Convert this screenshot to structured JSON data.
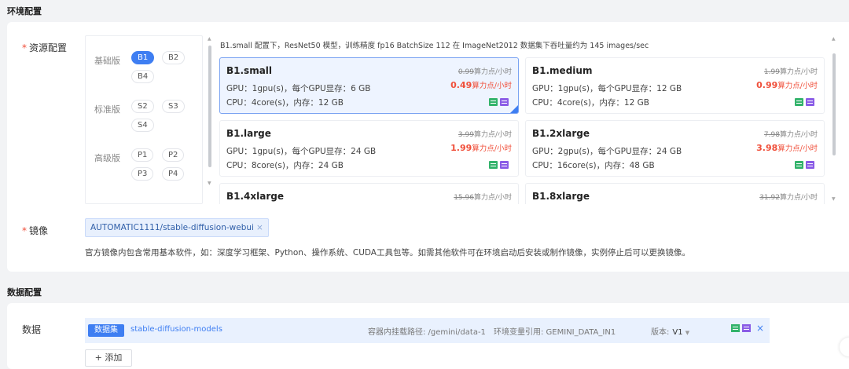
{
  "env_section": {
    "title": "环境配置",
    "resource_label": "资源配置",
    "required_mark": "*",
    "tiers": [
      {
        "name": "基础版",
        "options": [
          "B1",
          "B2",
          "B4"
        ],
        "selected": "B1"
      },
      {
        "name": "标准版",
        "options": [
          "S2",
          "S3",
          "S4"
        ]
      },
      {
        "name": "高级版",
        "options": [
          "P1",
          "P2",
          "P3",
          "P4"
        ]
      }
    ],
    "spec_description": "B1.small 配置下，ResNet50 模型，训练精度 fp16 BatchSize 112 在 ImageNet2012 数据集下吞吐量约为 145 images/sec",
    "price_unit": "算力点/小时",
    "cards": [
      {
        "name": "B1.small",
        "gpu": "GPU：1gpu(s)，每个GPU显存：6 GB",
        "cpu": "CPU：4core(s)，内存：12 GB",
        "old_price": "0.99",
        "new_price": "0.49",
        "selected": true
      },
      {
        "name": "B1.medium",
        "gpu": "GPU：1gpu(s)，每个GPU显存：12 GB",
        "cpu": "CPU：4core(s)，内存：12 GB",
        "old_price": "1.99",
        "new_price": "0.99"
      },
      {
        "name": "B1.large",
        "gpu": "GPU：1gpu(s)，每个GPU显存：24 GB",
        "cpu": "CPU：8core(s)，内存：24 GB",
        "old_price": "3.99",
        "new_price": "1.99"
      },
      {
        "name": "B1.2xlarge",
        "gpu": "GPU：2gpu(s)，每个GPU显存：24 GB",
        "cpu": "CPU：16core(s)，内存：48 GB",
        "old_price": "7.98",
        "new_price": "3.98"
      },
      {
        "name": "B1.4xlarge",
        "old_price": "15.96"
      },
      {
        "name": "B1.8xlarge",
        "old_price": "31.92"
      }
    ],
    "image_label": "镜像",
    "image_tag": "AUTOMATIC1111/stable-diffusion-webui",
    "image_tag_close": "×",
    "image_note": "官方镜像内包含常用基本软件，如：深度学习框架、Python、操作系统、CUDA工具包等。如需其他软件可在环境启动后安装或制作镜像，实例停止后可以更换镜像。"
  },
  "data_section": {
    "title": "数据配置",
    "data_label": "数据",
    "dataset_badge": "数据集",
    "dataset_name": "stable-diffusion-models",
    "mount_path": "容器内挂载路径: /gemini/data-1",
    "env_var": "环境变量引用: GEMINI_DATA_IN1",
    "version_label": "版本:",
    "version_value": "V1",
    "remove": "×",
    "add_button": "添加",
    "add_icon": "+"
  },
  "colors": {
    "accent": "#3e7ef2",
    "price_red": "#f04f3a",
    "icon_green": "#33b36b",
    "icon_purple": "#8a5ce6"
  }
}
